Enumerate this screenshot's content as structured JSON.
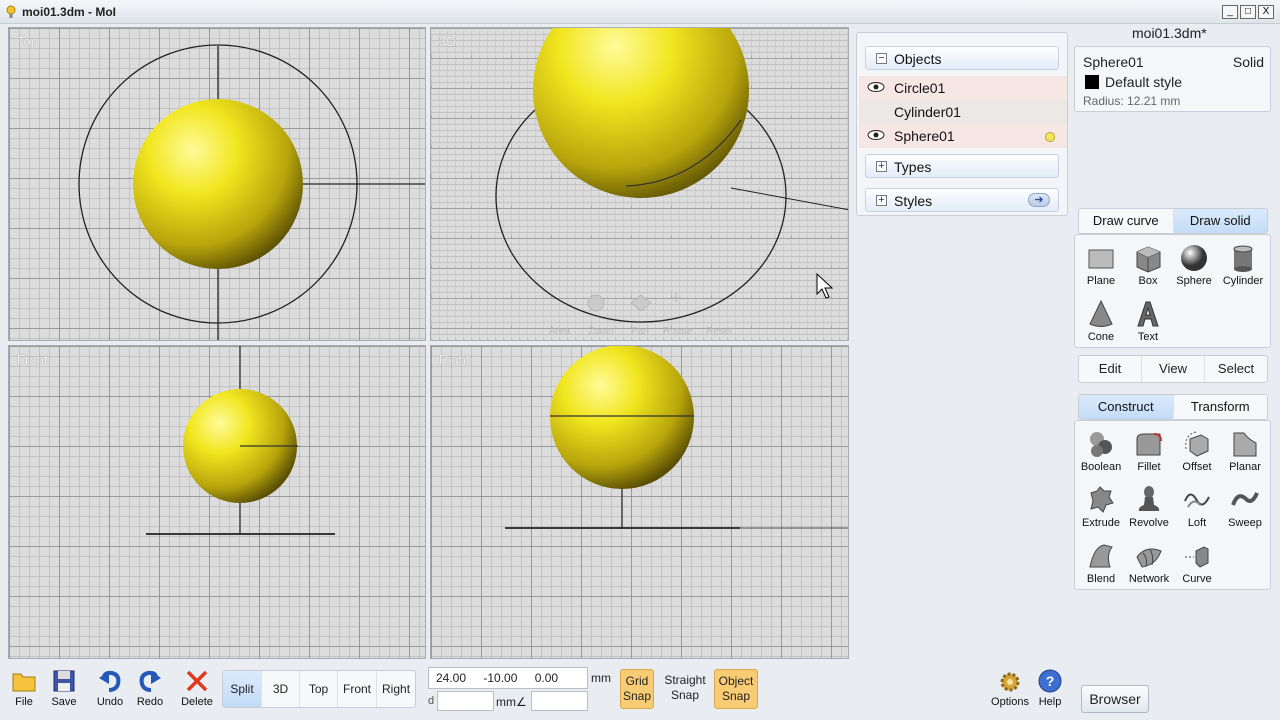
{
  "window": {
    "title": "moi01.3dm - MoI",
    "file_title": "moi01.3dm*",
    "controls": [
      "_",
      "□",
      "X"
    ]
  },
  "viewports": {
    "top": "Top",
    "threed": "3D",
    "front": "Front",
    "right": "Right"
  },
  "scene_panel": {
    "objects_header": "Objects",
    "objects": [
      {
        "name": "Circle01",
        "visible": true
      },
      {
        "name": "Cylinder01",
        "visible": false
      },
      {
        "name": "Sphere01",
        "visible": true,
        "selected": true
      }
    ],
    "types_header": "Types",
    "styles_header": "Styles"
  },
  "properties": {
    "name": "Sphere01",
    "type": "Solid",
    "style": "Default style",
    "style_color": "#000000",
    "radius": "Radius: 12.21 mm"
  },
  "draw_tabs": {
    "curve": "Draw curve",
    "solid": "Draw solid",
    "active": "solid"
  },
  "draw_solid_tools": [
    "Plane",
    "Box",
    "Sphere",
    "Cylinder",
    "Cone",
    "Text"
  ],
  "mode_buttons": [
    "Edit",
    "View",
    "Select"
  ],
  "construct_tabs": {
    "construct": "Construct",
    "transform": "Transform",
    "active": "construct"
  },
  "construct_tools": [
    "Boolean",
    "Fillet",
    "Offset",
    "Planar",
    "Extrude",
    "Revolve",
    "Loft",
    "Sweep",
    "Blend",
    "Network",
    "Curve"
  ],
  "bottom": {
    "file": "File",
    "save": "Save",
    "undo": "Undo",
    "redo": "Redo",
    "delete": "Delete",
    "view_tabs": [
      "Split",
      "3D",
      "Top",
      "Front",
      "Right"
    ],
    "active_view": "Split",
    "coords": "24.00 -10.00 0.00",
    "coord_unit": "mm",
    "distance_label": "d",
    "distance_unit": "mm",
    "angle_symbol": "∠",
    "grid_snap": [
      "Grid",
      "Snap"
    ],
    "straight_snap": [
      "Straight",
      "Snap"
    ],
    "object_snap": [
      "Object",
      "Snap"
    ],
    "options": "Options",
    "help": "Help",
    "browser": "Browser"
  },
  "colors": {
    "sphere": "#e8de1c",
    "snap_on": "#f8cc75",
    "active_tab": "#c3dcf7"
  }
}
